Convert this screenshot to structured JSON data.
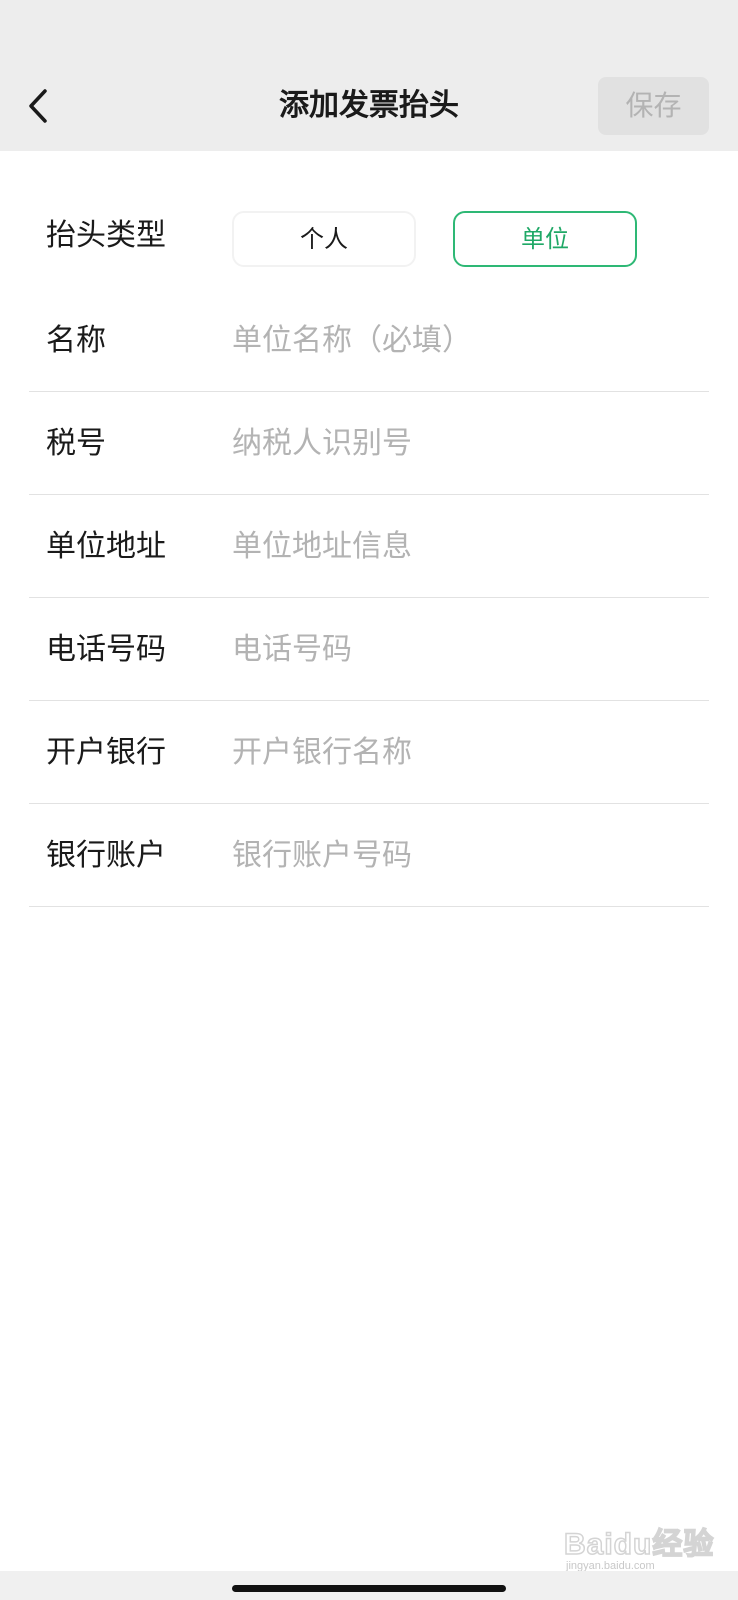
{
  "header": {
    "title": "添加发票抬头",
    "save_label": "保存"
  },
  "type_selector": {
    "label": "抬头类型",
    "options": [
      "个人",
      "单位"
    ],
    "selected": "单位"
  },
  "fields": [
    {
      "label": "名称",
      "placeholder": "单位名称（必填）",
      "value": ""
    },
    {
      "label": "税号",
      "placeholder": "纳税人识别号",
      "value": ""
    },
    {
      "label": "单位地址",
      "placeholder": "单位地址信息",
      "value": ""
    },
    {
      "label": "电话号码",
      "placeholder": "电话号码",
      "value": ""
    },
    {
      "label": "开户银行",
      "placeholder": "开户银行名称",
      "value": ""
    },
    {
      "label": "银行账户",
      "placeholder": "银行账户号码",
      "value": ""
    }
  ],
  "watermark": {
    "brand": "Baidu经验",
    "domain": "jingyan.baidu.com"
  },
  "colors": {
    "accent": "#2eb875",
    "header_bg": "#ededed",
    "placeholder": "#b3b3b3"
  },
  "icons": {
    "back": "chevron-left-icon"
  }
}
